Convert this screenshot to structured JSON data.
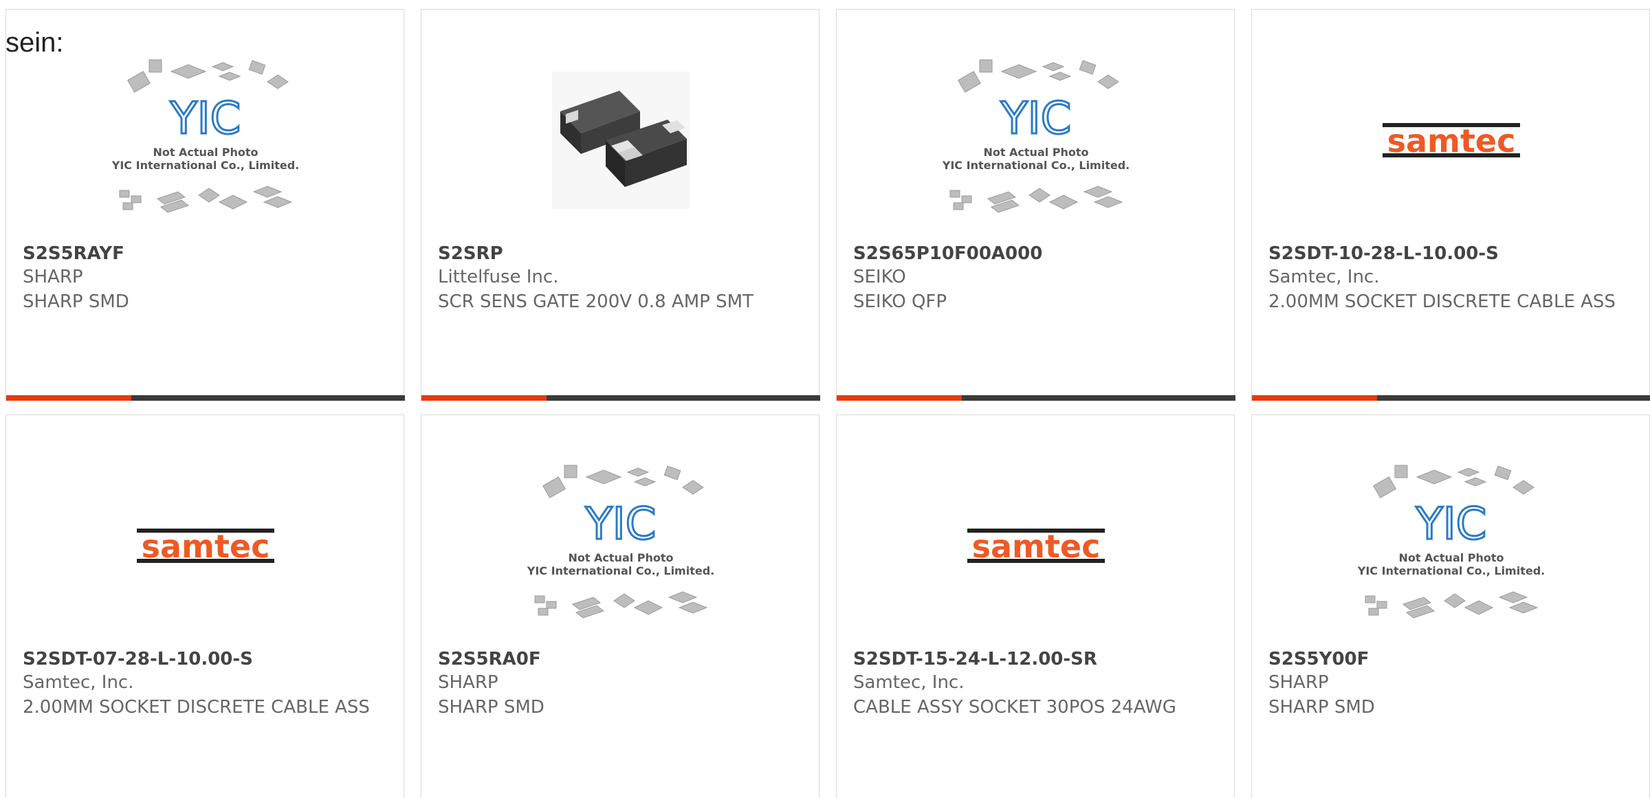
{
  "intro_text": "sein:",
  "placeholder_caption": {
    "line1": "Not Actual Photo",
    "line2": "YIC International Co., Limited."
  },
  "logo_text": "samtec",
  "yic_text": "YIC",
  "colors": {
    "accent": "#e8390d",
    "bar": "#3a3a3a",
    "samtec_orange": "#ee5a24"
  },
  "cards": [
    {
      "part": "S2S5RAYF",
      "maker": "SHARP",
      "desc": "SHARP SMD",
      "image": "yic-placeholder"
    },
    {
      "part": "S2SRP",
      "maker": "Littelfuse Inc.",
      "desc": "SCR SENS GATE 200V 0.8 AMP SMT",
      "image": "chip-photo"
    },
    {
      "part": "S2S65P10F00A000",
      "maker": "SEIKO",
      "desc": "SEIKO QFP",
      "image": "yic-placeholder"
    },
    {
      "part": "S2SDT-10-28-L-10.00-S",
      "maker": "Samtec, Inc.",
      "desc": "2.00MM SOCKET DISCRETE CABLE ASS",
      "image": "samtec-logo"
    },
    {
      "part": "S2SDT-07-28-L-10.00-S",
      "maker": "Samtec, Inc.",
      "desc": "2.00MM SOCKET DISCRETE CABLE ASS",
      "image": "samtec-logo"
    },
    {
      "part": "S2S5RA0F",
      "maker": "SHARP",
      "desc": "SHARP SMD",
      "image": "yic-placeholder"
    },
    {
      "part": "S2SDT-15-24-L-12.00-SR",
      "maker": "Samtec, Inc.",
      "desc": "CABLE ASSY SOCKET 30POS 24AWG",
      "image": "samtec-logo"
    },
    {
      "part": "S2S5Y00F",
      "maker": "SHARP",
      "desc": "SHARP SMD",
      "image": "yic-placeholder"
    }
  ]
}
